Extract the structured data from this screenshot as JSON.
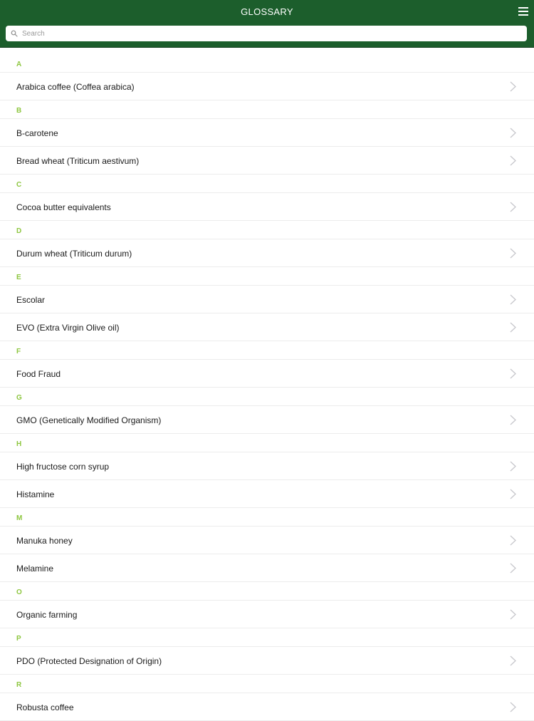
{
  "header": {
    "title": "GLOSSARY",
    "menu_icon": "hamburger-menu-icon",
    "background": "#1c5e2c"
  },
  "search": {
    "placeholder": "Search",
    "value": ""
  },
  "accent_color": "#8dc63f",
  "sections": [
    {
      "letter": "A",
      "items": [
        "Arabica coffee (Coffea arabica)"
      ]
    },
    {
      "letter": "B",
      "items": [
        "B-carotene",
        "Bread wheat (Triticum aestivum)"
      ]
    },
    {
      "letter": "C",
      "items": [
        "Cocoa butter equivalents"
      ]
    },
    {
      "letter": "D",
      "items": [
        "Durum wheat (Triticum durum)"
      ]
    },
    {
      "letter": "E",
      "items": [
        "Escolar",
        "EVO (Extra Virgin Olive oil)"
      ]
    },
    {
      "letter": "F",
      "items": [
        "Food Fraud"
      ]
    },
    {
      "letter": "G",
      "items": [
        "GMO (Genetically Modified Organism)"
      ]
    },
    {
      "letter": "H",
      "items": [
        "High fructose corn syrup",
        "Histamine"
      ]
    },
    {
      "letter": "M",
      "items": [
        "Manuka honey",
        "Melamine"
      ]
    },
    {
      "letter": "O",
      "items": [
        "Organic farming"
      ]
    },
    {
      "letter": "P",
      "items": [
        "PDO (Protected Designation of Origin)"
      ]
    },
    {
      "letter": "R",
      "items": [
        "Robusta coffee"
      ]
    }
  ]
}
